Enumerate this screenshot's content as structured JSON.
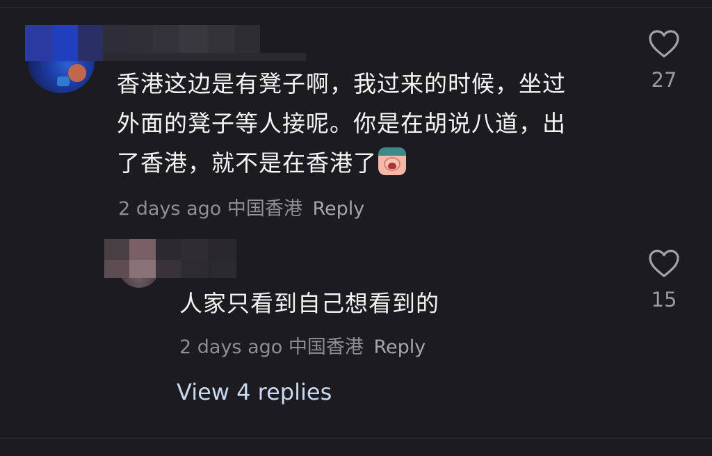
{
  "comments": [
    {
      "text_line1": "香港这边是有凳子啊，我过来的时候，坐过",
      "text_line2": "外面的凳子等人接呢。你是在胡说八道，出",
      "text_line3": "了香港，就不是在香港了",
      "time": "2 days ago",
      "location": "中国香港",
      "reply_label": "Reply",
      "likes": "27"
    },
    {
      "text_line1": "人家只看到自己想看到的",
      "time": "2 days ago",
      "location": "中国香港",
      "reply_label": "Reply",
      "likes": "15"
    }
  ],
  "view_replies_label": "View 4 replies",
  "icons": {
    "like": "heart-outline-icon",
    "reaction": "crying-face-emoji"
  },
  "colors": {
    "background": "#1c1b20",
    "text": "#f4f4f4",
    "meta": "#8e8e93",
    "link": "#c9d9f0"
  }
}
